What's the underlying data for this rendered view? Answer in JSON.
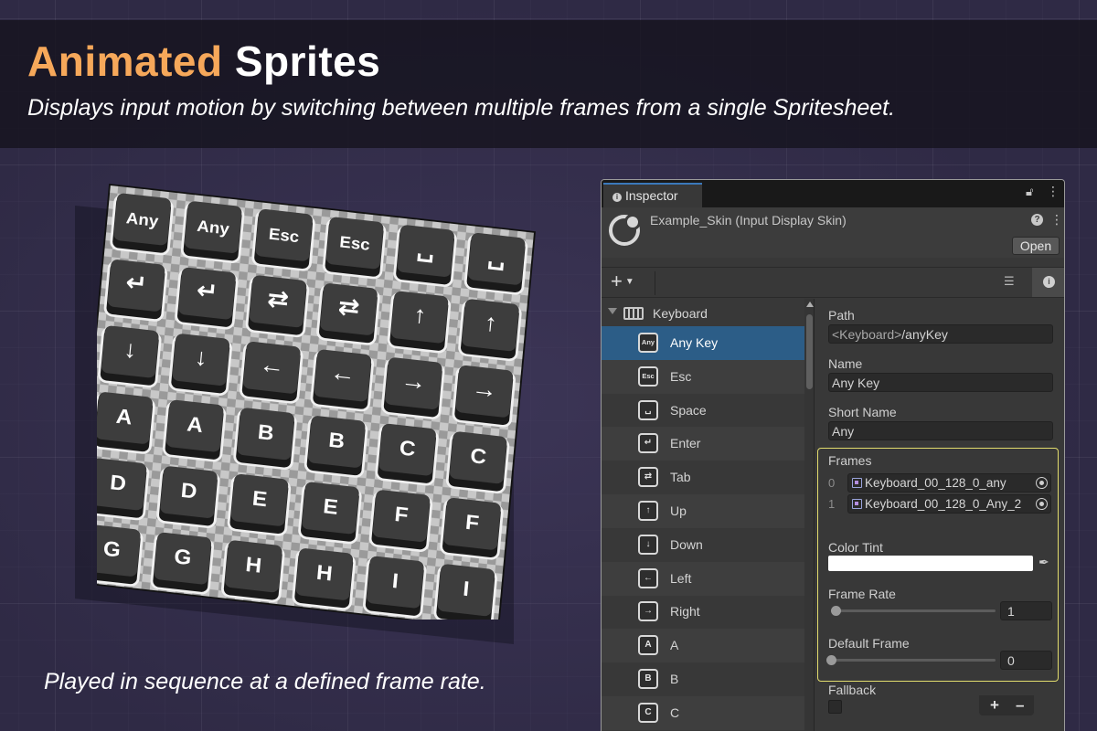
{
  "banner": {
    "title_accent": "Animated",
    "title_rest": "Sprites",
    "subtitle": "Displays input motion by switching between multiple frames from a single Spritesheet."
  },
  "caption": "Played in sequence at a defined frame rate.",
  "spritesheet": {
    "rows": [
      [
        "Any",
        "Any",
        "Esc",
        "Esc",
        "space-icon",
        "space-icon"
      ],
      [
        "enter-icon",
        "enter-icon",
        "tab-icon",
        "tab-icon",
        "up-arrow-icon",
        "up-arrow-icon"
      ],
      [
        "down-arrow-icon",
        "down-arrow-icon",
        "left-arrow-icon",
        "left-arrow-icon",
        "right-arrow-icon",
        "right-arrow-icon"
      ],
      [
        "A",
        "A",
        "B",
        "B",
        "C",
        "C"
      ],
      [
        "D",
        "D",
        "E",
        "E",
        "F",
        "F"
      ],
      [
        "G",
        "G",
        "H",
        "H",
        "I",
        "I"
      ]
    ]
  },
  "inspector": {
    "tab_label": "Inspector",
    "asset_name": "Example_Skin (Input Display Skin)",
    "open_label": "Open",
    "add_label": "+",
    "tree": {
      "parent_label": "Keyboard",
      "items": [
        {
          "icon": "Any",
          "label": "Any Key"
        },
        {
          "icon": "Esc",
          "label": "Esc"
        },
        {
          "icon": "space-icon",
          "label": "Space"
        },
        {
          "icon": "enter-icon",
          "label": "Enter"
        },
        {
          "icon": "tab-icon",
          "label": "Tab"
        },
        {
          "icon": "up-arrow-icon",
          "label": "Up"
        },
        {
          "icon": "down-arrow-icon",
          "label": "Down"
        },
        {
          "icon": "left-arrow-icon",
          "label": "Left"
        },
        {
          "icon": "right-arrow-icon",
          "label": "Right"
        },
        {
          "icon": "A",
          "label": "A"
        },
        {
          "icon": "B",
          "label": "B"
        },
        {
          "icon": "C",
          "label": "C"
        }
      ]
    },
    "props": {
      "path_label": "Path",
      "path_prefix": "<Keyboard>",
      "path_suffix": "/anyKey",
      "name_label": "Name",
      "name_value": "Any Key",
      "short_name_label": "Short Name",
      "short_name_value": "Any",
      "frames_label": "Frames",
      "frames": [
        {
          "index": "0",
          "value": "Keyboard_00_128_0_any"
        },
        {
          "index": "1",
          "value": "Keyboard_00_128_0_Any_2"
        }
      ],
      "color_tint_label": "Color Tint",
      "color_tint_value": "#ffffff",
      "frame_rate_label": "Frame Rate",
      "frame_rate_value": "1",
      "default_frame_label": "Default Frame",
      "default_frame_value": "0",
      "fallback_label": "Fallback"
    }
  },
  "colors": {
    "accent": "#f6a85a",
    "selection": "#2c5d87",
    "highlight_box": "#e2dc6d"
  }
}
